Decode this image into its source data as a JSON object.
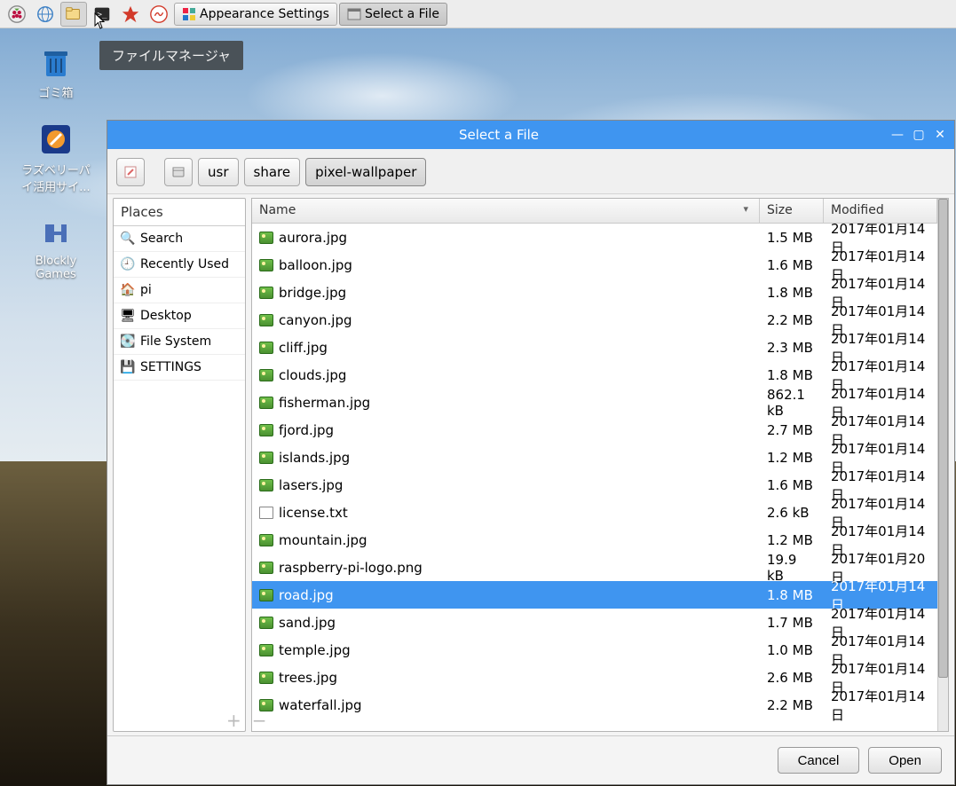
{
  "taskbar": {
    "appearance_label": "Appearance Settings",
    "select_file_label": "Select a File",
    "tooltip": "ファイルマネージャ"
  },
  "desktop": {
    "trash_label": "ゴミ箱",
    "raspi_label": "ラズベリーパイ活用サイ...",
    "blockly_label": "Blockly Games"
  },
  "dialog": {
    "title": "Select a File",
    "breadcrumb": {
      "edit": "",
      "disk": "",
      "usr": "usr",
      "share": "share",
      "current": "pixel-wallpaper"
    },
    "places_header": "Places",
    "places": [
      {
        "icon": "search",
        "label": "Search"
      },
      {
        "icon": "recent",
        "label": "Recently Used"
      },
      {
        "icon": "home",
        "label": "pi"
      },
      {
        "icon": "desktop",
        "label": "Desktop"
      },
      {
        "icon": "disk",
        "label": "File System"
      },
      {
        "icon": "floppy",
        "label": "SETTINGS"
      }
    ],
    "columns": {
      "name": "Name",
      "size": "Size",
      "modified": "Modified"
    },
    "files": [
      {
        "name": "aurora.jpg",
        "size": "1.5 MB",
        "mod": "2017年01月14日",
        "type": "img"
      },
      {
        "name": "balloon.jpg",
        "size": "1.6 MB",
        "mod": "2017年01月14日",
        "type": "img"
      },
      {
        "name": "bridge.jpg",
        "size": "1.8 MB",
        "mod": "2017年01月14日",
        "type": "img"
      },
      {
        "name": "canyon.jpg",
        "size": "2.2 MB",
        "mod": "2017年01月14日",
        "type": "img"
      },
      {
        "name": "cliff.jpg",
        "size": "2.3 MB",
        "mod": "2017年01月14日",
        "type": "img"
      },
      {
        "name": "clouds.jpg",
        "size": "1.8 MB",
        "mod": "2017年01月14日",
        "type": "img"
      },
      {
        "name": "fisherman.jpg",
        "size": "862.1 kB",
        "mod": "2017年01月14日",
        "type": "img"
      },
      {
        "name": "fjord.jpg",
        "size": "2.7 MB",
        "mod": "2017年01月14日",
        "type": "img"
      },
      {
        "name": "islands.jpg",
        "size": "1.2 MB",
        "mod": "2017年01月14日",
        "type": "img"
      },
      {
        "name": "lasers.jpg",
        "size": "1.6 MB",
        "mod": "2017年01月14日",
        "type": "img"
      },
      {
        "name": "license.txt",
        "size": "2.6 kB",
        "mod": "2017年01月14日",
        "type": "txt"
      },
      {
        "name": "mountain.jpg",
        "size": "1.2 MB",
        "mod": "2017年01月14日",
        "type": "img"
      },
      {
        "name": "raspberry-pi-logo.png",
        "size": "19.9 kB",
        "mod": "2017年01月20日",
        "type": "img"
      },
      {
        "name": "road.jpg",
        "size": "1.8 MB",
        "mod": "2017年01月14日",
        "type": "img",
        "selected": true
      },
      {
        "name": "sand.jpg",
        "size": "1.7 MB",
        "mod": "2017年01月14日",
        "type": "img"
      },
      {
        "name": "temple.jpg",
        "size": "1.0 MB",
        "mod": "2017年01月14日",
        "type": "img"
      },
      {
        "name": "trees.jpg",
        "size": "2.6 MB",
        "mod": "2017年01月14日",
        "type": "img"
      },
      {
        "name": "waterfall.jpg",
        "size": "2.2 MB",
        "mod": "2017年01月14日",
        "type": "img"
      }
    ],
    "cancel": "Cancel",
    "open": "Open"
  }
}
